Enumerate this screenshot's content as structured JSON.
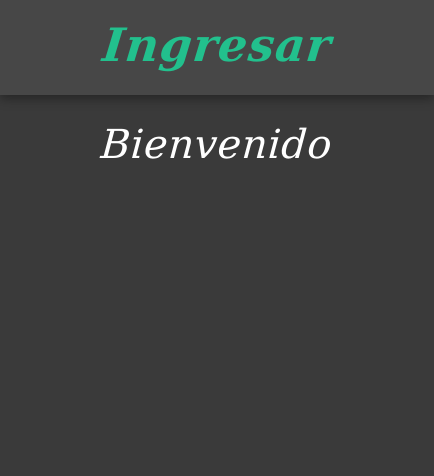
{
  "header": {
    "title": "Ingresar",
    "accent_color": "#22c08d"
  },
  "main": {
    "welcome_text": "Bienvenido"
  },
  "colors": {
    "background": "#3a3a3a",
    "header_background": "#474747",
    "text": "#ffffff"
  }
}
